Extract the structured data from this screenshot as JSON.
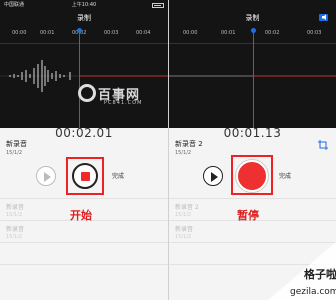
{
  "status_bar": {
    "carrier": "中国联通",
    "wifi": "wifi-icon",
    "time": "上午10:40"
  },
  "nav": {
    "title": "录制",
    "speaker_icon": "speaker-icon"
  },
  "ruler": {
    "left": [
      "00:00",
      "00:01",
      "00:02",
      "00:03",
      "00:04"
    ],
    "right": [
      "00:00",
      "00:01",
      "00:02",
      "00:03"
    ]
  },
  "watermark": {
    "main": "百事网",
    "sub": "PC841.COM"
  },
  "left": {
    "timer": "00:02.01",
    "name": "新录音",
    "date": "15/1/2",
    "done": "完成",
    "caption": "开始",
    "list": [
      {
        "title": "新录音",
        "date": "15/1/2",
        "duration": ""
      },
      {
        "title": "新录音",
        "date": "15/1/2",
        "duration": ""
      }
    ]
  },
  "right": {
    "timer": "00:01.13",
    "name": "新录音 2",
    "date": "15/1/2",
    "done": "完成",
    "caption": "暂停",
    "list": [
      {
        "title": "新录音 2",
        "date": "15/1/2",
        "duration": ""
      },
      {
        "title": "新录音",
        "date": "15/1/2",
        "duration": ""
      }
    ]
  },
  "colors": {
    "accent_blue": "#1e6de2",
    "record_red": "#ee3030",
    "caption_red": "#e21c1c"
  },
  "site": {
    "name": "格子啦",
    "url": "gezila.com"
  }
}
